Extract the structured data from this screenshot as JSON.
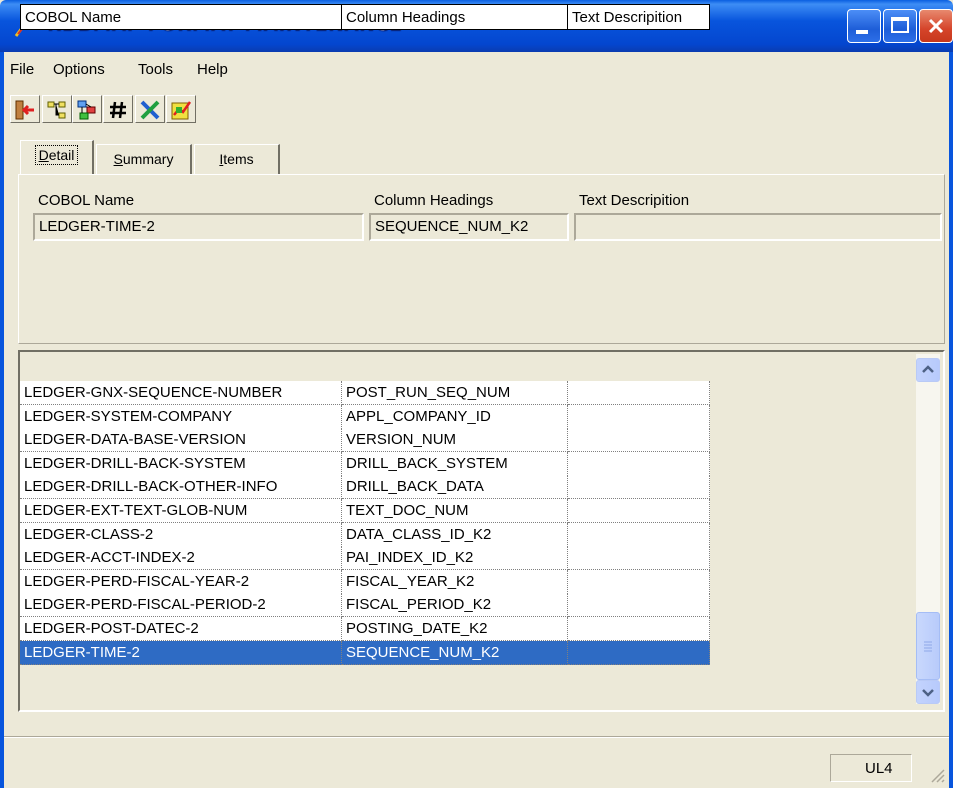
{
  "window": {
    "title": "RDBMAP FORMAT MAINTENANCE"
  },
  "menu": {
    "file": "File",
    "options": "Options",
    "tools": "Tools",
    "help": "Help"
  },
  "toolbar": {
    "icons": [
      "exit-icon",
      "tree-icon",
      "tree-alt-icon",
      "hash-icon",
      "cross-tool-icon",
      "chart-icon"
    ]
  },
  "tabs": {
    "detail": {
      "u": "D",
      "rest": "etail"
    },
    "summary": {
      "u": "S",
      "rest": "ummary"
    },
    "items": {
      "u": "I",
      "rest": "tems"
    }
  },
  "detail": {
    "cobol_label": "COBOL Name",
    "column_label": "Column Headings",
    "text_label": "Text Descripition",
    "cobol_value": "LEDGER-TIME-2",
    "column_value": "SEQUENCE_NUM_K2",
    "text_value": ""
  },
  "grid": {
    "headers": {
      "cobol": "COBOL Name",
      "column": "Column Headings",
      "text": "Text Descripition"
    },
    "rows": [
      {
        "cobol": "LEDGER-GNX-SEQUENCE-NUMBER",
        "column": "POST_RUN_SEQ_NUM",
        "text": ""
      },
      {
        "cobol": "LEDGER-SYSTEM-COMPANY",
        "column": "APPL_COMPANY_ID",
        "text": ""
      },
      {
        "cobol": "LEDGER-DATA-BASE-VERSION",
        "column": "VERSION_NUM",
        "text": ""
      },
      {
        "cobol": "LEDGER-DRILL-BACK-SYSTEM",
        "column": "DRILL_BACK_SYSTEM",
        "text": ""
      },
      {
        "cobol": "LEDGER-DRILL-BACK-OTHER-INFO",
        "column": "DRILL_BACK_DATA",
        "text": ""
      },
      {
        "cobol": "LEDGER-EXT-TEXT-GLOB-NUM",
        "column": "TEXT_DOC_NUM",
        "text": ""
      },
      {
        "cobol": "LEDGER-CLASS-2",
        "column": "DATA_CLASS_ID_K2",
        "text": ""
      },
      {
        "cobol": "LEDGER-ACCT-INDEX-2",
        "column": "PAI_INDEX_ID_K2",
        "text": ""
      },
      {
        "cobol": "LEDGER-PERD-FISCAL-YEAR-2",
        "column": "FISCAL_YEAR_K2",
        "text": ""
      },
      {
        "cobol": "LEDGER-PERD-FISCAL-PERIOD-2",
        "column": "FISCAL_PERIOD_K2",
        "text": ""
      },
      {
        "cobol": "LEDGER-POST-DATEC-2",
        "column": "POSTING_DATE_K2",
        "text": ""
      },
      {
        "cobol": "LEDGER-TIME-2",
        "column": "SEQUENCE_NUM_K2",
        "text": "",
        "selected": true
      }
    ]
  },
  "status": {
    "pane": "UL4"
  },
  "colors": {
    "titlebar": "#0855dd",
    "selection": "#2e6bc4",
    "face": "#ece9d8"
  }
}
